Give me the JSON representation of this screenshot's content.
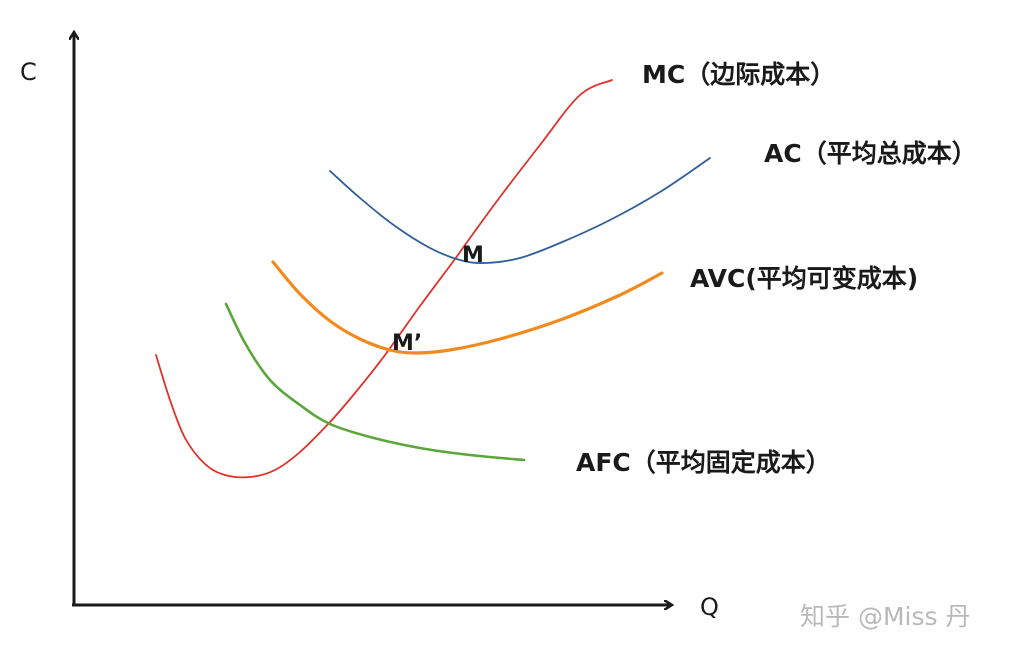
{
  "chart_data": {
    "type": "line",
    "xlabel": "Q",
    "ylabel": "C",
    "series": [
      {
        "name": "MC（边际成本）",
        "key": "mc",
        "color": "#e0312b",
        "points": [
          [
            156,
            355
          ],
          [
            170,
            400
          ],
          [
            185,
            438
          ],
          [
            205,
            464
          ],
          [
            225,
            475
          ],
          [
            250,
            477
          ],
          [
            275,
            470
          ],
          [
            300,
            452
          ],
          [
            330,
            422
          ],
          [
            355,
            393
          ],
          [
            385,
            355
          ],
          [
            420,
            306
          ],
          [
            455,
            259
          ],
          [
            470,
            238
          ],
          [
            500,
            197
          ],
          [
            540,
            145
          ],
          [
            580,
            95
          ],
          [
            612,
            80
          ]
        ]
      },
      {
        "name": "AC（平均总成本）",
        "key": "ac",
        "color": "#2f5f98",
        "points": [
          [
            330,
            171
          ],
          [
            360,
            198
          ],
          [
            395,
            226
          ],
          [
            430,
            248
          ],
          [
            460,
            260
          ],
          [
            485,
            263
          ],
          [
            520,
            258
          ],
          [
            560,
            243
          ],
          [
            610,
            220
          ],
          [
            660,
            192
          ],
          [
            710,
            158
          ]
        ]
      },
      {
        "name": "AVC(平均可变成本)",
        "key": "avc",
        "color": "#f28a1e",
        "points": [
          [
            273,
            262
          ],
          [
            300,
            294
          ],
          [
            330,
            321
          ],
          [
            360,
            339
          ],
          [
            390,
            350
          ],
          [
            415,
            353
          ],
          [
            450,
            350
          ],
          [
            500,
            339
          ],
          [
            560,
            320
          ],
          [
            620,
            295
          ],
          [
            662,
            273
          ]
        ]
      },
      {
        "name": "AFC（平均固定成本）",
        "key": "afc",
        "color": "#5aa63a",
        "points": [
          [
            226,
            304
          ],
          [
            245,
            343
          ],
          [
            270,
            380
          ],
          [
            300,
            405
          ],
          [
            330,
            424
          ],
          [
            370,
            437
          ],
          [
            420,
            448
          ],
          [
            470,
            455
          ],
          [
            524,
            460
          ]
        ]
      }
    ],
    "points": [
      {
        "label": "M",
        "on": [
          "mc",
          "ac"
        ]
      },
      {
        "label": "M’",
        "on": [
          "mc",
          "avc"
        ]
      }
    ],
    "watermark": "知乎 @Miss 丹"
  }
}
